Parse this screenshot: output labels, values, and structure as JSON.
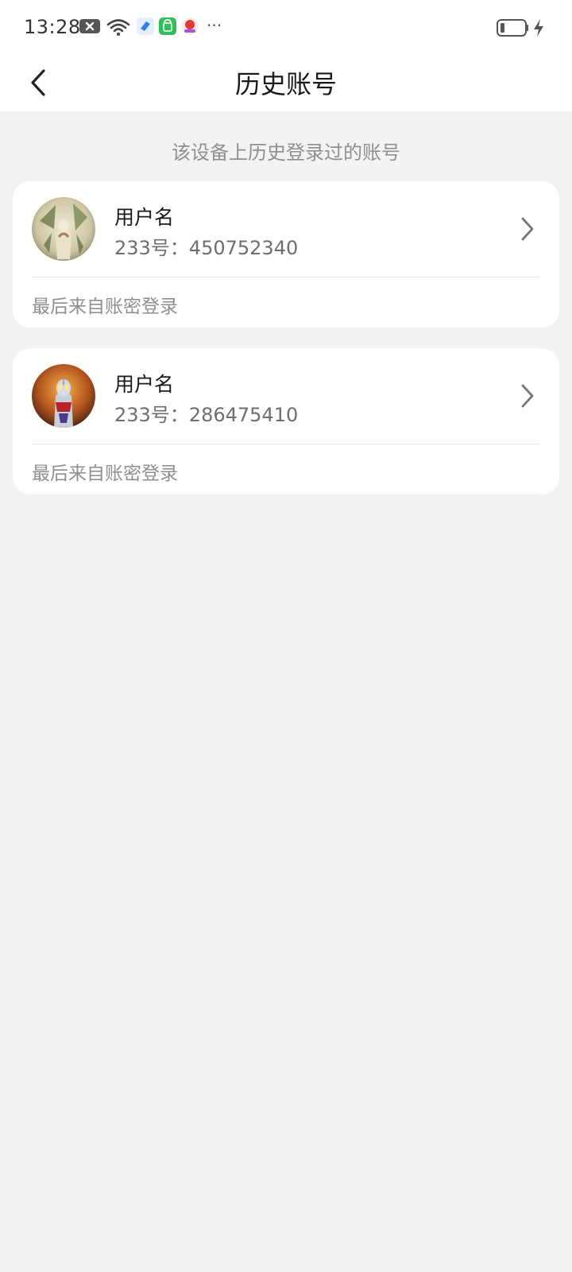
{
  "status_bar": {
    "time": "13:28",
    "icons": [
      "notification-x-icon",
      "wifi-icon",
      "app-blue-icon",
      "app-green-bag-icon",
      "app-red-icon",
      "more-dots-icon"
    ],
    "more": "···",
    "battery": "battery-charging-icon"
  },
  "nav": {
    "title": "历史账号",
    "back_icon": "back-chevron-icon"
  },
  "hint": "该设备上历史登录过的账号",
  "accounts": [
    {
      "username": "用户名",
      "id_text": "233号：450752340",
      "login_source": "最后来自账密登录"
    },
    {
      "username": "用户名",
      "id_text": "233号：286475410",
      "login_source": "最后来自账密登录"
    }
  ],
  "colors": {
    "background": "#f3f3f3",
    "card": "#ffffff",
    "secondary_text": "#8f8f8f"
  }
}
